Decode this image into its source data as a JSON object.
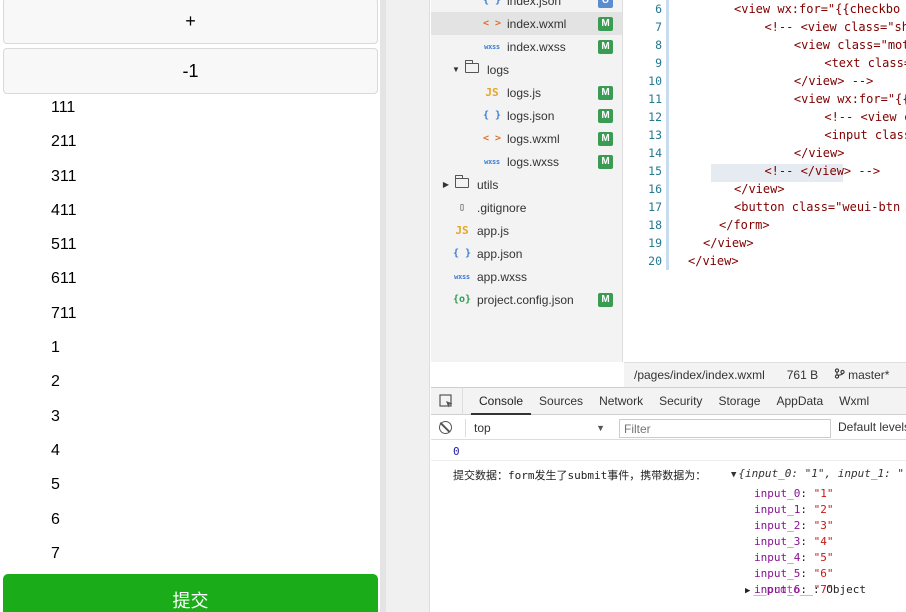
{
  "simulator": {
    "plus_label": "+",
    "minus_label": "-1",
    "items": [
      "111",
      "211",
      "311",
      "411",
      "511",
      "611",
      "711",
      "1",
      "2",
      "3",
      "4",
      "5",
      "6",
      "7"
    ],
    "submit_label": "提交"
  },
  "file_tree": [
    {
      "name": "index.json",
      "icon": "json-icon",
      "badge": "U",
      "selected": false
    },
    {
      "name": "index.wxml",
      "icon": "wxml-icon",
      "badge": "M",
      "selected": true
    },
    {
      "name": "index.wxss",
      "icon": "wxss-icon",
      "badge": "M",
      "selected": false
    },
    {
      "name": "logs",
      "icon": "folder-open-icon",
      "badge": "",
      "selected": false
    },
    {
      "name": "logs.js",
      "icon": "js-icon",
      "badge": "M",
      "selected": false
    },
    {
      "name": "logs.json",
      "icon": "json-icon",
      "badge": "M",
      "selected": false
    },
    {
      "name": "logs.wxml",
      "icon": "wxml-icon",
      "badge": "M",
      "selected": false
    },
    {
      "name": "logs.wxss",
      "icon": "wxss-icon",
      "badge": "M",
      "selected": false
    },
    {
      "name": "utils",
      "icon": "folder-icon",
      "badge": "",
      "selected": false
    },
    {
      "name": ".gitignore",
      "icon": "file-icon",
      "badge": "",
      "selected": false
    },
    {
      "name": "app.js",
      "icon": "js-icon",
      "badge": "",
      "selected": false
    },
    {
      "name": "app.json",
      "icon": "json-icon",
      "badge": "",
      "selected": false
    },
    {
      "name": "app.wxss",
      "icon": "wxss-icon",
      "badge": "",
      "selected": false
    },
    {
      "name": "project.config.json",
      "icon": "config-icon",
      "badge": "M",
      "selected": false
    }
  ],
  "editor": {
    "line_numbers": [
      "6",
      "7",
      "8",
      "9",
      "10",
      "11",
      "12",
      "13",
      "14",
      "15",
      "16",
      "17",
      "18",
      "19",
      "20"
    ],
    "lines": [
      "<view wx:for=\"{{checkbo",
      "  <!-- <view class=\"shi",
      "    <view class=\"moto-c",
      "      <text class=\"moto",
      "    </view> -->",
      "    <view wx:for=\"{{tex",
      "      <!-- <view class=",
      "      <input class=\"tex",
      "    </view>",
      "  <!-- </view> -->",
      "</view>",
      "<button class=\"weui-btn",
      "</form>",
      "</view>",
      "</view>"
    ]
  },
  "status_bar": {
    "path": "/pages/index/index.wxml",
    "size": "761 B",
    "branch": "master*"
  },
  "devtools": {
    "tabs": [
      "Console",
      "Sources",
      "Network",
      "Security",
      "Storage",
      "AppData",
      "Wxml"
    ],
    "active_tab": "Console",
    "context": "top",
    "filter_placeholder": "Filter",
    "levels_label": "Default levels",
    "log_number": "0",
    "log_message": "提交数据：form发生了submit事件，携带数据为：",
    "object_preview": "{input_0: \"1\", input_1: \"",
    "properties": [
      {
        "key": "input_0",
        "value": "\"1\""
      },
      {
        "key": "input_1",
        "value": "\"2\""
      },
      {
        "key": "input_2",
        "value": "\"3\""
      },
      {
        "key": "input_3",
        "value": "\"4\""
      },
      {
        "key": "input_4",
        "value": "\"5\""
      },
      {
        "key": "input_5",
        "value": "\"6\""
      },
      {
        "key": "input_6",
        "value": "\"7\""
      }
    ],
    "proto_key": "__proto__",
    "proto_value": "Object"
  }
}
